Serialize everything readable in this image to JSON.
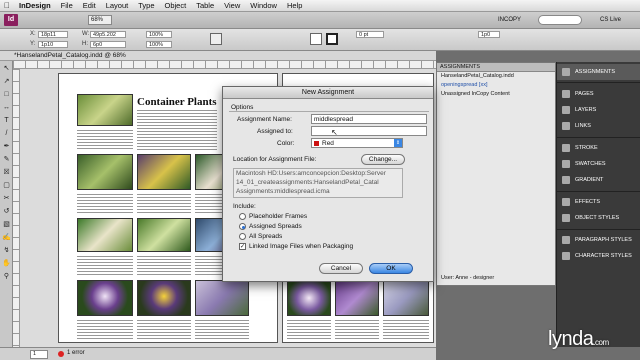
{
  "menubar": {
    "apple": "",
    "items": [
      "InDesign",
      "File",
      "Edit",
      "Layout",
      "Type",
      "Object",
      "Table",
      "View",
      "Window",
      "Help"
    ],
    "clock": "",
    "user": ""
  },
  "appbar": {
    "logo": "Id",
    "zoom": "68%",
    "workspace": "INCOPY",
    "search_label": "CS Live"
  },
  "control": {
    "x_label": "X:",
    "x_value": "18p11",
    "y_label": "Y:",
    "y_value": "1p10",
    "w_label": "W:",
    "w_value": "49p5.202",
    "h_label": "H:",
    "h_value": "6p0",
    "zoom1": "100%",
    "zoom2": "100%",
    "stroke": "0 pt",
    "gutter": "1p0"
  },
  "document": {
    "tab_title": "*HanselandPetal_Catalog.indd @ 68%",
    "page_heading": "Container Plants"
  },
  "statusbar": {
    "page": "1",
    "errors": "1 error"
  },
  "assignments_panel": {
    "header": "ASSIGNMENTS",
    "items": [
      "HanselandPetal_Catalog.indd",
      "openingspread [xx]",
      "Unassigned InCopy Content"
    ],
    "footer_user": "User: Anne - designer"
  },
  "dock": {
    "items": [
      {
        "label": "ASSIGNMENTS",
        "active": true
      },
      {
        "label": "PAGES"
      },
      {
        "label": "LAYERS"
      },
      {
        "label": "LINKS"
      },
      {
        "label": "STROKE"
      },
      {
        "label": "SWATCHES"
      },
      {
        "label": "GRADIENT"
      },
      {
        "label": "EFFECTS"
      },
      {
        "label": "OBJECT STYLES"
      },
      {
        "label": "PARAGRAPH STYLES"
      },
      {
        "label": "CHARACTER STYLES"
      }
    ]
  },
  "dialog": {
    "title": "New Assignment",
    "options_label": "Options",
    "assignment_name_label": "Assignment Name:",
    "assignment_name_value": "middlespread",
    "assigned_to_label": "Assigned to:",
    "assigned_to_value": "",
    "color_label": "Color:",
    "color_value": "Red",
    "color_swatch": "#cc1111",
    "location_label": "Location for Assignment File:",
    "change_button": "Change...",
    "path_line1": "Macintosh HD:Users:amconcepcion:Desktop:Server",
    "path_line2": "14_01_createassignments:HanselandPetal_Catal",
    "path_line3": "Assignments:middlespread.icma",
    "include_label": "Include:",
    "radio_placeholder": "Placeholder Frames",
    "radio_assigned": "Assigned Spreads",
    "radio_all": "All Spreads",
    "checkbox_linked": "Linked Image Files when Packaging",
    "cancel_button": "Cancel",
    "ok_button": "OK"
  },
  "watermark": {
    "brand": "lynda",
    "suffix": ".com"
  },
  "colors": {
    "ok_button": "#3a86e3",
    "dock_bg": "#3a3a3a"
  }
}
